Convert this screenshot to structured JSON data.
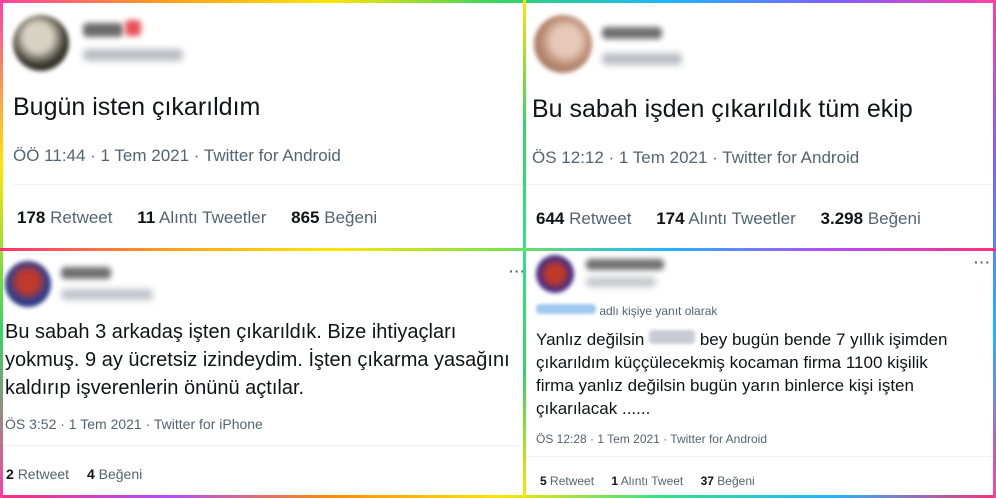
{
  "colors": {
    "text": "#0f1419",
    "muted": "#536471",
    "link": "#1d9bf0",
    "divider": "#eff3f4"
  },
  "tweets": [
    {
      "text": "Bugün isten çıkarıldım",
      "meta": "ÖÖ 11:44 · 1 Tem 2021 · Twitter for Android",
      "retweets": "178",
      "retweet_label": "Retweet",
      "quotes": "11",
      "quote_label": "Alıntı Tweetler",
      "likes": "865",
      "like_label": "Beğeni"
    },
    {
      "text": "Bu sabah işden çıkarıldık tüm ekip",
      "meta": "ÖS 12:12 · 1 Tem 2021 · Twitter for Android",
      "retweets": "644",
      "retweet_label": "Retweet",
      "quotes": "174",
      "quote_label": "Alıntı Tweetler",
      "likes": "3.298",
      "like_label": "Beğeni"
    },
    {
      "lines": [
        "Bu sabah 3 arkadaş işten çıkarıldık. Bize ihtiyaçları",
        "yokmuş. 9 ay ücretsiz izindeydim. İşten çıkarma yasağını",
        "kaldırıp işverenlerin önünü açtılar."
      ],
      "meta": "ÖS 3:52 · 1 Tem 2021 · Twitter for iPhone",
      "retweets": "2",
      "retweet_label": "Retweet",
      "likes": "4",
      "like_label": "Beğeni",
      "more_icon": "···"
    },
    {
      "reply_suffix": "adlı kişiye yanıt olarak",
      "line1_a": "Yanlız değilsin",
      "line1_b": "bey bugün bende 7 yıllık işimden",
      "lines": [
        "çıkarıldım küççülecekmiş kocaman firma 1100 kişilik",
        "firma yanlız değilsin bugün yarın binlerce kişi işten",
        "çıkarılacak ......"
      ],
      "meta": "ÖS 12:28 · 1 Tem 2021 · Twitter for Android",
      "retweets": "5",
      "retweet_label": "Retweet",
      "quotes": "1",
      "quote_label": "Alıntı Tweet",
      "likes": "37",
      "like_label": "Beğeni",
      "more_icon": "···"
    }
  ]
}
